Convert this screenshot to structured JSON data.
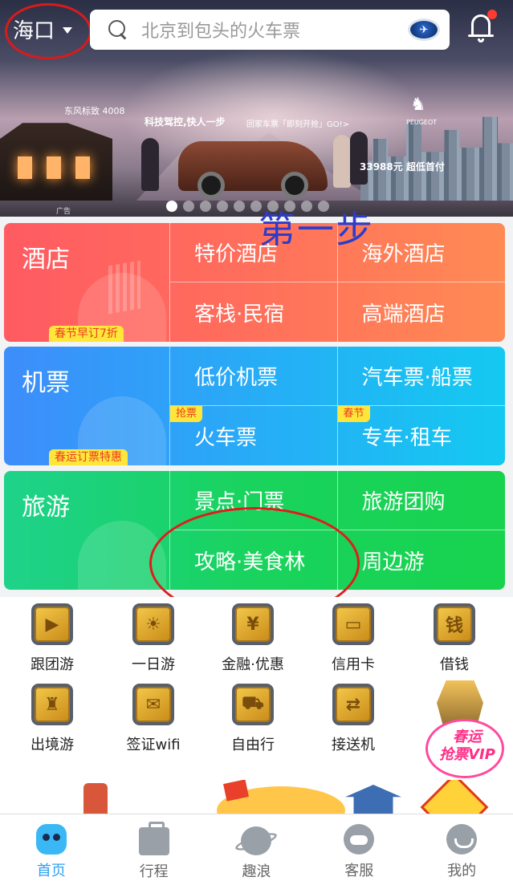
{
  "header": {
    "city": "海口",
    "search_placeholder": "北京到包头的火车票",
    "plane_icon": "✈"
  },
  "banner": {
    "brand": "东风标致 4008",
    "slogan": "科技驾控,快人一步",
    "slogan2": "回家车票「即刻开抢」GO!>",
    "logo_glyph": "♞",
    "logo_text": "PEUGEOT",
    "price": "33988元 超低首付",
    "ad_label": "广告",
    "dots_total": 10,
    "dots_active": 1
  },
  "annotations": {
    "step_label": "第一步"
  },
  "categories": [
    {
      "key": "hotel",
      "title": "酒店",
      "badge": "春节早订7折",
      "items": [
        {
          "label": "特价酒店",
          "tag": ""
        },
        {
          "label": "海外酒店",
          "tag": ""
        },
        {
          "label": "客栈·民宿",
          "tag": ""
        },
        {
          "label": "高端酒店",
          "tag": ""
        }
      ]
    },
    {
      "key": "flight",
      "title": "机票",
      "badge": "春运订票特惠",
      "items": [
        {
          "label": "低价机票",
          "tag": ""
        },
        {
          "label": "汽车票·船票",
          "tag": ""
        },
        {
          "label": "火车票",
          "tag": "抢票"
        },
        {
          "label": "专车·租车",
          "tag": "春节"
        }
      ]
    },
    {
      "key": "travel",
      "title": "旅游",
      "badge": "",
      "items": [
        {
          "label": "景点·门票",
          "tag": ""
        },
        {
          "label": "旅游团购",
          "tag": ""
        },
        {
          "label": "攻略·美食林",
          "tag": ""
        },
        {
          "label": "周边游",
          "tag": ""
        }
      ]
    }
  ],
  "quick_icons": [
    {
      "label": "跟团游",
      "glyph": "▶"
    },
    {
      "label": "一日游",
      "glyph": "☀"
    },
    {
      "label": "金融·优惠",
      "glyph": "¥"
    },
    {
      "label": "信用卡",
      "glyph": "▭"
    },
    {
      "label": "借钱",
      "glyph": "钱"
    },
    {
      "label": "出境游",
      "glyph": "♜"
    },
    {
      "label": "签证wifi",
      "glyph": "✉"
    },
    {
      "label": "自由行",
      "glyph": "⛟"
    },
    {
      "label": "接送机",
      "glyph": "⇄"
    }
  ],
  "vip": {
    "line1": "春运",
    "line2": "抢票VIP"
  },
  "tabs": [
    {
      "label": "首页",
      "icon": "home-mascot-icon",
      "active": true
    },
    {
      "label": "行程",
      "icon": "briefcase-icon",
      "active": false
    },
    {
      "label": "趣浪",
      "icon": "planet-icon",
      "active": false
    },
    {
      "label": "客服",
      "icon": "headset-icon",
      "active": false
    },
    {
      "label": "我的",
      "icon": "smiley-user-icon",
      "active": false
    }
  ],
  "colors": {
    "hotel_gradient": [
      "#ff5b62",
      "#ff8a54"
    ],
    "flight_gradient": [
      "#3d8dfb",
      "#14c9f1"
    ],
    "travel_gradient": [
      "#1ed28a",
      "#17d34e"
    ],
    "active_tab": "#2aa1f0",
    "badge_bg": "#ffe63b",
    "badge_text": "#e93c22",
    "annotation_red": "#e11b1b",
    "annotation_blue": "#2d3dc9"
  }
}
